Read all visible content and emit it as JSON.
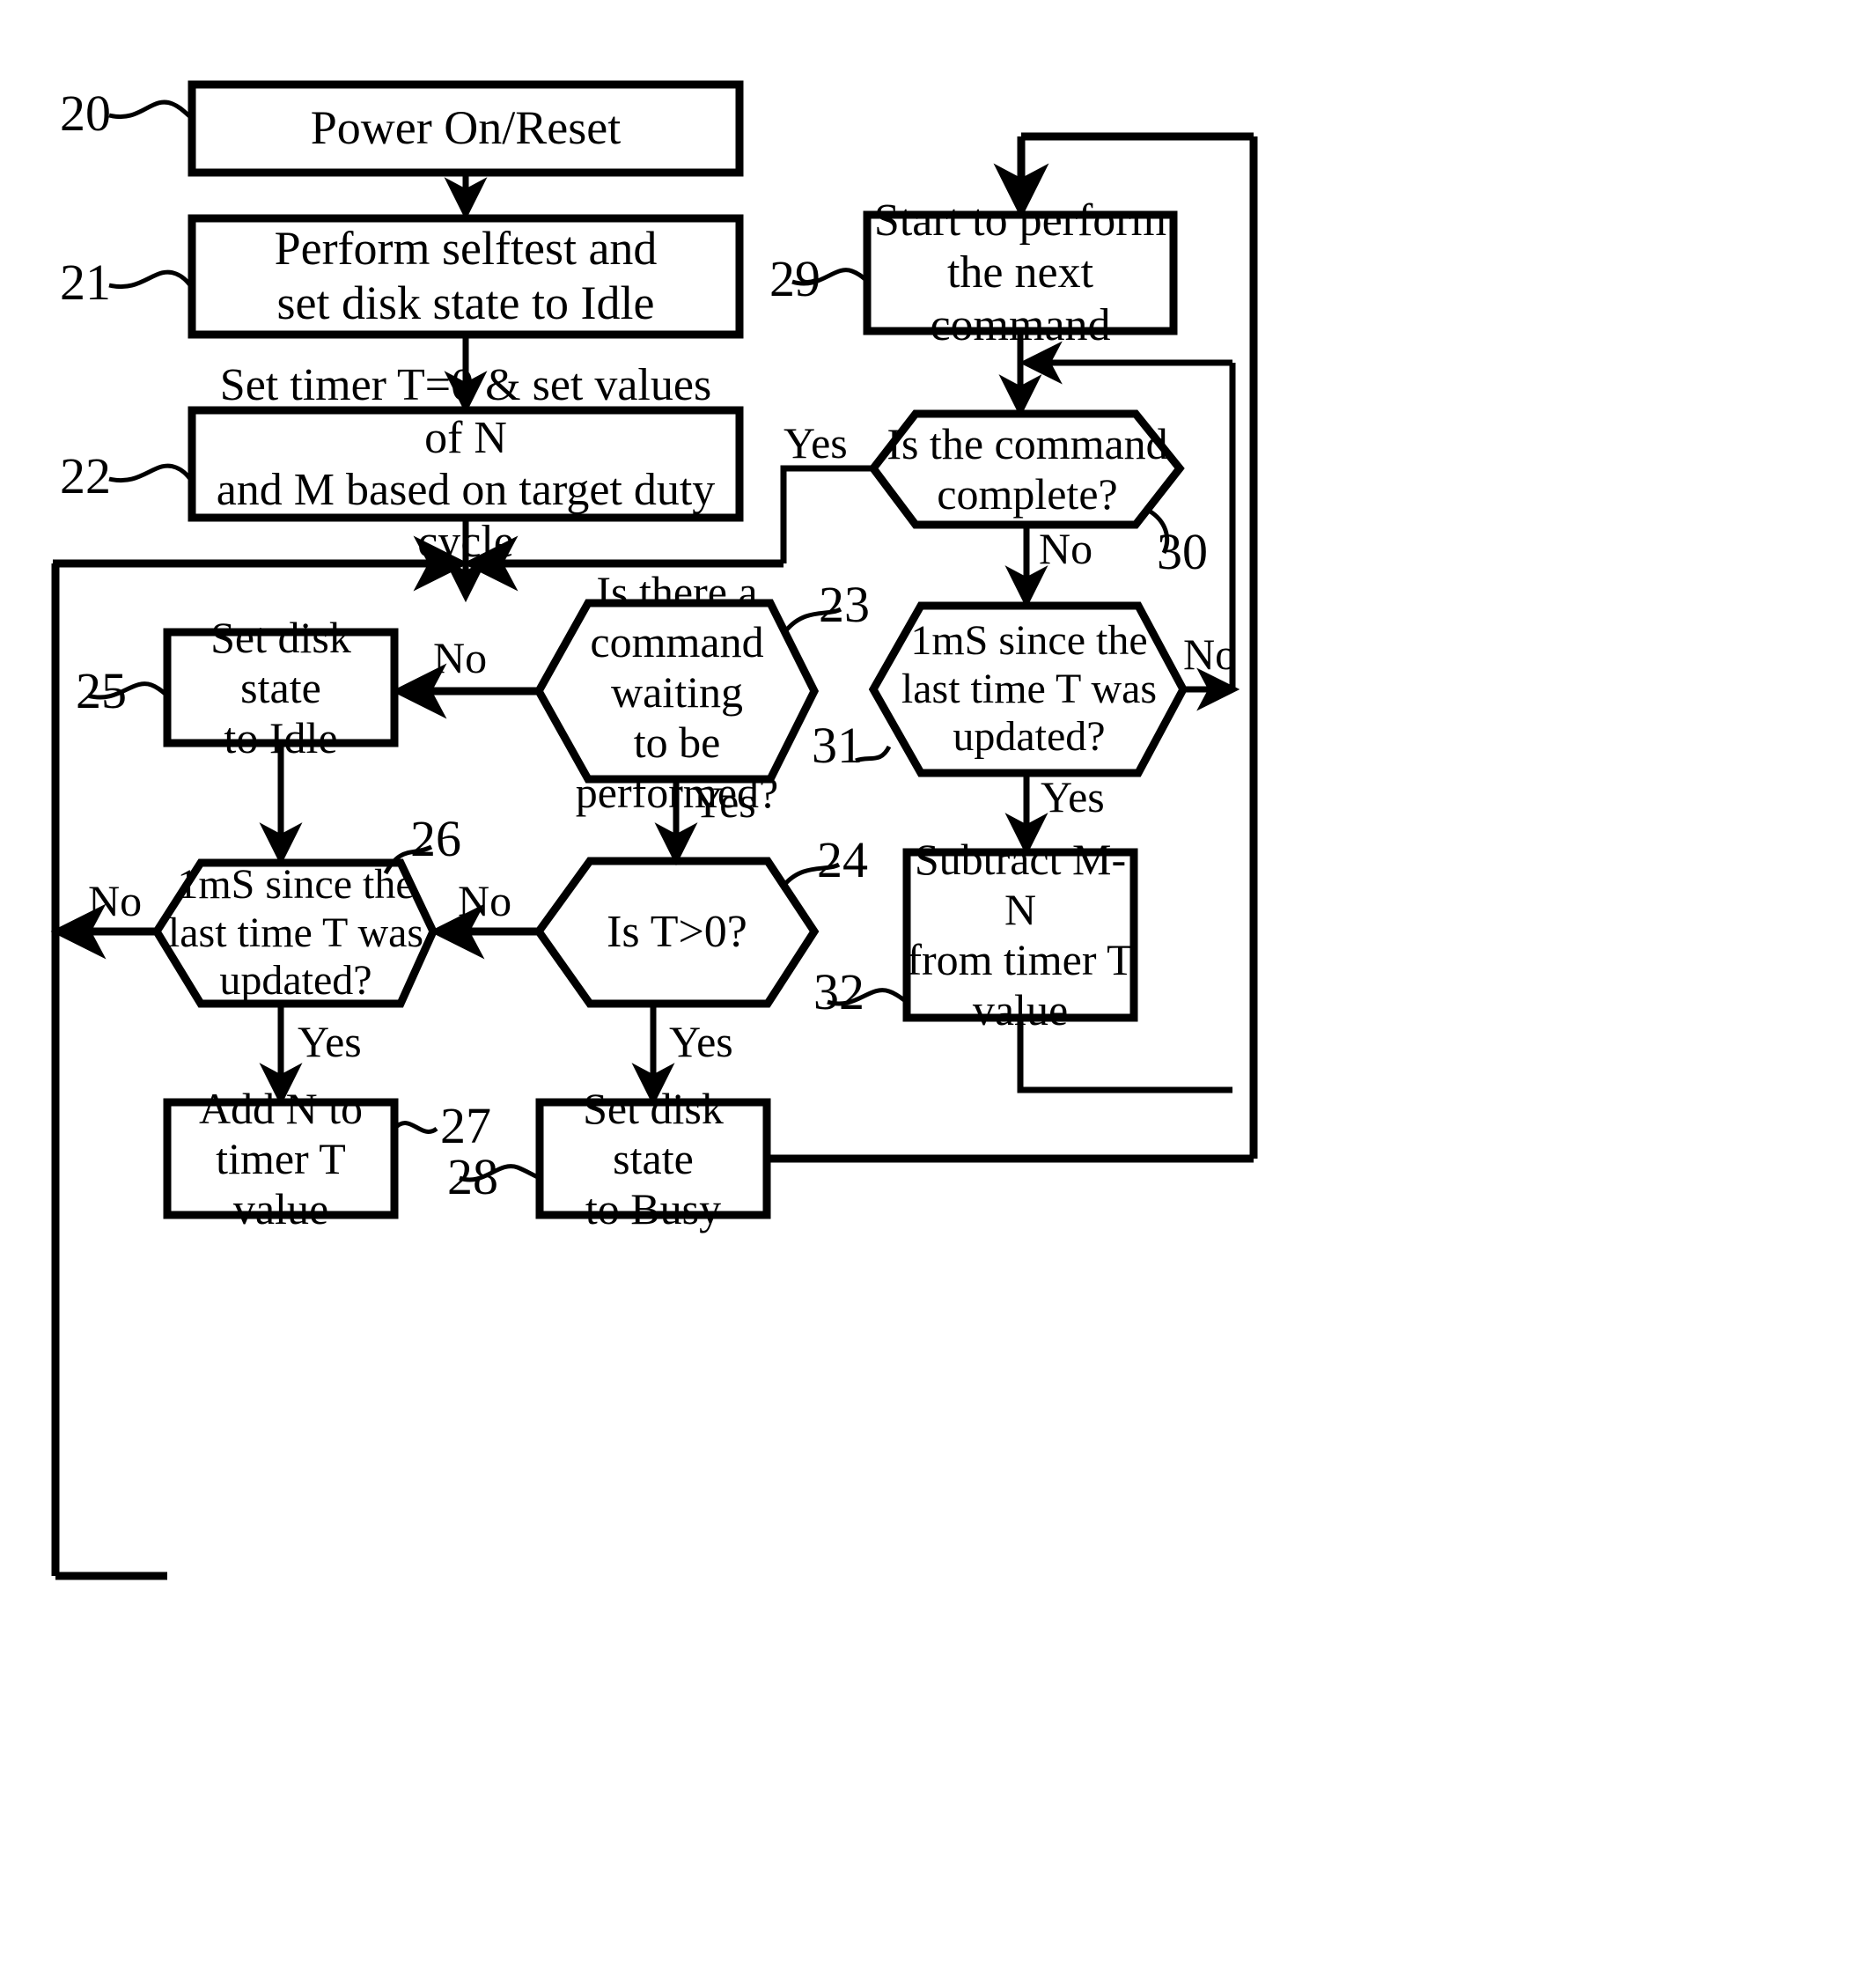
{
  "figure": {
    "type": "flowchart",
    "title": "Disk drive duty-cycle control flowchart",
    "background_color": "#ffffff",
    "line_color": "#000000"
  },
  "nodes": [
    {
      "ref": "20",
      "shape": "process",
      "text": "Power On/Reset"
    },
    {
      "ref": "21",
      "shape": "process",
      "text": "Perform selftest and\nset disk state to Idle"
    },
    {
      "ref": "22",
      "shape": "process",
      "text": "Set timer T=0 & set values of N\nand M based on target duty cycle"
    },
    {
      "ref": "23",
      "shape": "decision",
      "text": "Is there a\ncommand waiting\nto be performed?"
    },
    {
      "ref": "24",
      "shape": "decision",
      "text": "Is T>0?"
    },
    {
      "ref": "25",
      "shape": "process",
      "text": "Set disk state\nto Idle"
    },
    {
      "ref": "26",
      "shape": "decision",
      "text": "1mS since the\nlast time T was\nupdated?"
    },
    {
      "ref": "27",
      "shape": "process",
      "text": "Add N to\ntimer T value"
    },
    {
      "ref": "28",
      "shape": "process",
      "text": "Set disk state\nto Busy"
    },
    {
      "ref": "29",
      "shape": "process",
      "text": "Start to perform\nthe next command"
    },
    {
      "ref": "30",
      "shape": "decision",
      "text": "Is the command\ncomplete?"
    },
    {
      "ref": "31",
      "shape": "decision",
      "text": "1mS since the\nlast time T was\nupdated?"
    },
    {
      "ref": "32",
      "shape": "process",
      "text": "Subtract M-N\nfrom timer T\nvalue"
    }
  ],
  "edge_labels": {
    "node23_no": "No",
    "node23_yes": "Yes",
    "node24_no": "No",
    "node24_yes": "Yes",
    "node26_no_left": "No",
    "node26_yes": "Yes",
    "node30_yes": "Yes",
    "node30_no": "No",
    "node31_no": "No",
    "node31_yes": "Yes"
  },
  "ref_numbers": {
    "n20": "20",
    "n21": "21",
    "n22": "22",
    "n23": "23",
    "n24": "24",
    "n25": "25",
    "n26": "26",
    "n27": "27",
    "n28": "28",
    "n29": "29",
    "n30": "30",
    "n31": "31",
    "n32": "32"
  }
}
